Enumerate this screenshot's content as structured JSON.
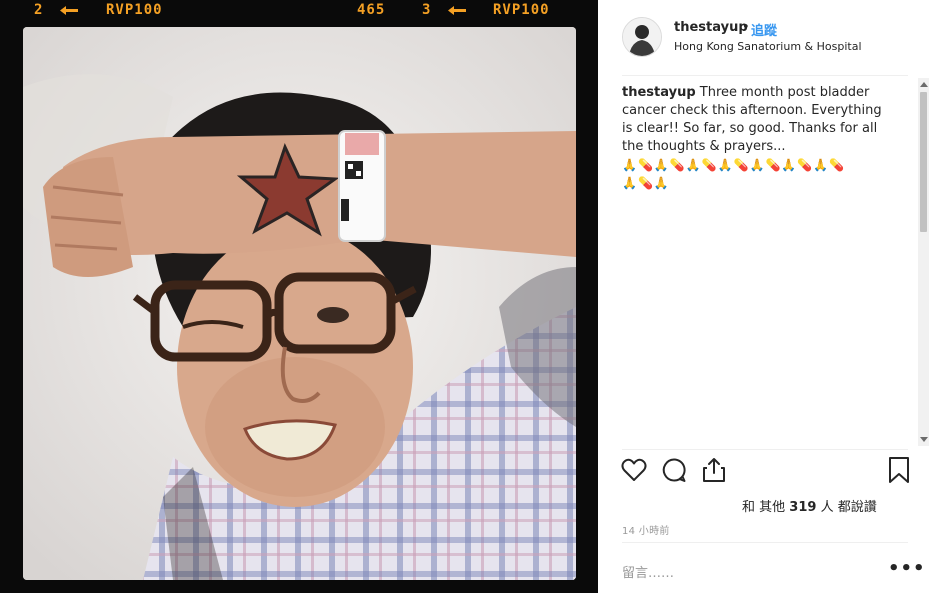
{
  "film": {
    "left_frame": "2",
    "left_brand": "RVP100",
    "counter": "465",
    "right_frame": "3",
    "right_brand": "RVP100"
  },
  "post": {
    "username": "thestayup",
    "separator": "•",
    "follow_label": "追蹤",
    "location": "Hong Kong Sanatorium & Hospital",
    "caption_user": "thestayup",
    "caption_text": "Three month post bladder cancer check this afternoon. Everything is clear!! So far, so good. Thanks for all the thoughts & prayers...",
    "emoji_line1": "🙏💊🙏💊🙏💊🙏💊🙏💊🙏💊🙏💊",
    "emoji_line2": "🙏💊🙏",
    "likes_prefix": "和 其他",
    "likes_count": "319",
    "likes_suffix": "人 都說讚",
    "timestamp": "14 小時前",
    "comment_placeholder": "留言……",
    "more_label": "•••"
  },
  "icons": {
    "like": "heart-icon",
    "comment": "comment-bubble-icon",
    "share": "share-icon",
    "save": "bookmark-icon",
    "film_arrow": "film-arrow-icon"
  },
  "colors": {
    "film_text": "#f4a024",
    "link_blue": "#3897f0",
    "muted": "#999999"
  }
}
